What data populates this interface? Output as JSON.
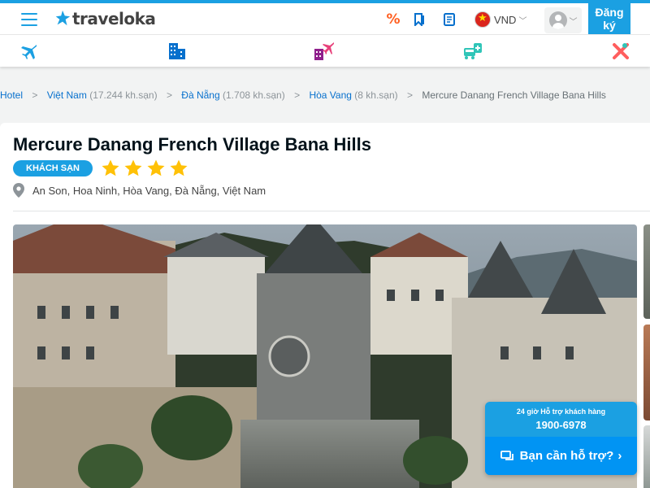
{
  "header": {
    "logo_text": "traveloka",
    "currency": "VND",
    "register_label": "Đăng ký",
    "icons": [
      "menu-icon",
      "percent-icon",
      "bookmark-icon",
      "receipt-icon",
      "vietnam-flag-icon",
      "avatar-icon",
      "chevron-down-icon"
    ],
    "accent_color": "#1ba0e2"
  },
  "product_nav": {
    "items": [
      "flight-icon",
      "hotel-icon",
      "flight-hotel-icon",
      "transport-icon",
      "activity-icon"
    ]
  },
  "breadcrumb": {
    "items": [
      {
        "label": "Hotel",
        "count": ""
      },
      {
        "label": "Việt Nam",
        "count": "(17.244 kh.sạn)"
      },
      {
        "label": "Đà Nẵng",
        "count": "(1.708 kh.sạn)"
      },
      {
        "label": "Hòa Vang",
        "count": "(8 kh.sạn)"
      }
    ],
    "current": "Mercure Danang French Village Bana Hills"
  },
  "hotel": {
    "name": "Mercure Danang French Village Bana Hills",
    "type_badge": "KHÁCH SẠN",
    "star_rating": 4,
    "address": "An Son, Hoa Ninh, Hòa Vang, Đà Nẵng, Việt Nam"
  },
  "support": {
    "caption": "24 giờ Hỗ trợ khách hàng",
    "phone": "1900-6978",
    "button_label": "Bạn cần hỗ trợ?",
    "arrow": "›"
  }
}
